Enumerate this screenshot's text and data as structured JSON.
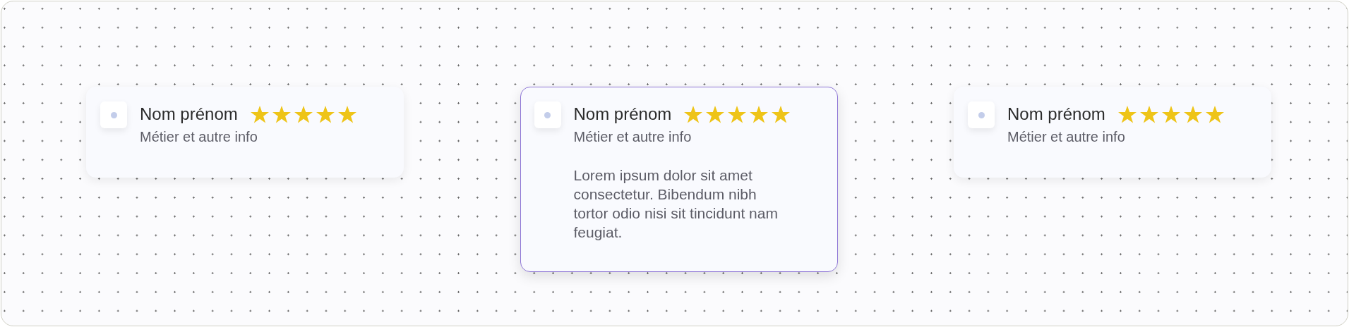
{
  "cards": [
    {
      "name": "Nom prénom",
      "subtitle": "Métier et autre info",
      "stars": 5,
      "selected": false
    },
    {
      "name": "Nom prénom",
      "subtitle": "Métier et autre info",
      "stars": 5,
      "selected": true,
      "text": "Lorem ipsum dolor sit amet consectetur. Bibendum nibh tortor odio nisi sit tincidunt nam feugiat."
    },
    {
      "name": "Nom prénom",
      "subtitle": "Métier et autre info",
      "stars": 5,
      "selected": false
    }
  ]
}
